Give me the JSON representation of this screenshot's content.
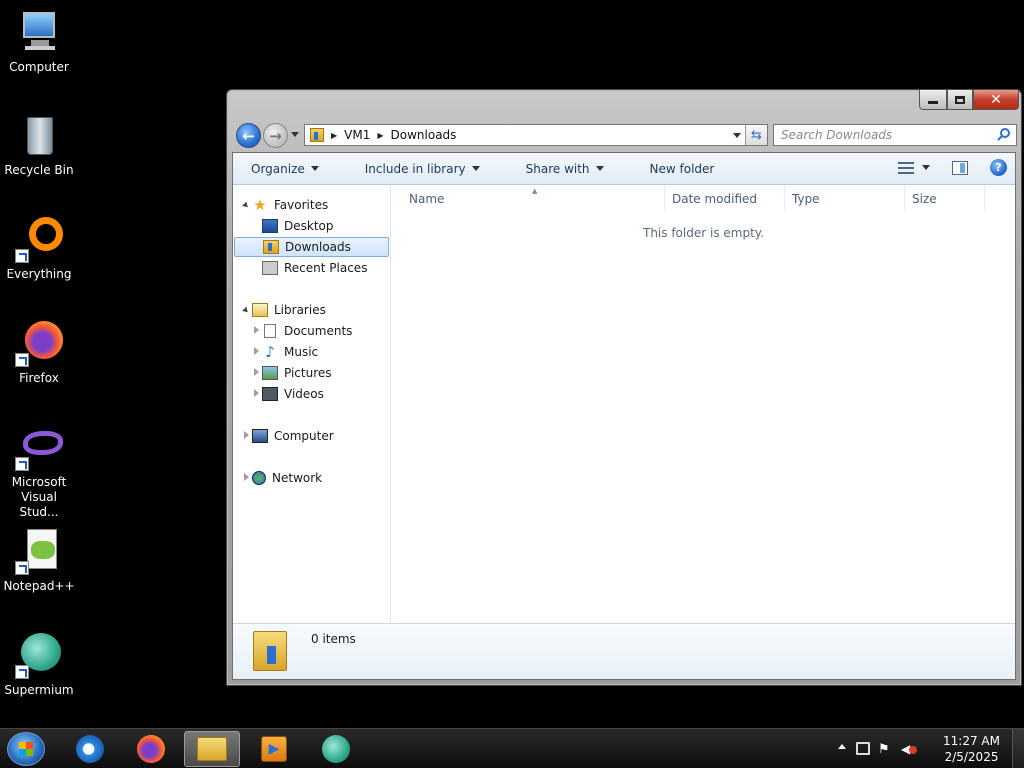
{
  "desktop": {
    "icons": [
      {
        "label": "Computer"
      },
      {
        "label": "Recycle Bin"
      },
      {
        "label": "Everything"
      },
      {
        "label": "Firefox"
      },
      {
        "label": "Microsoft Visual Stud..."
      },
      {
        "label": "Notepad++"
      },
      {
        "label": "Supermium"
      }
    ]
  },
  "window": {
    "breadcrumb": [
      "VM1",
      "Downloads"
    ],
    "search_placeholder": "Search Downloads",
    "toolbar": {
      "organize": "Organize",
      "include_in_library": "Include in library",
      "share_with": "Share with",
      "new_folder": "New folder",
      "help": "?"
    },
    "nav": {
      "favorites": "Favorites",
      "desktop": "Desktop",
      "downloads": "Downloads",
      "recent_places": "Recent Places",
      "libraries": "Libraries",
      "documents": "Documents",
      "music": "Music",
      "pictures": "Pictures",
      "videos": "Videos",
      "computer": "Computer",
      "network": "Network",
      "selected": "Downloads"
    },
    "columns": [
      "Name",
      "Date modified",
      "Type",
      "Size"
    ],
    "empty_message": "This folder is empty.",
    "details": {
      "items_count": "0 items"
    }
  },
  "taskbar": {
    "apps": [
      "internet-explorer",
      "firefox",
      "windows-explorer",
      "media-player",
      "supermium"
    ],
    "active_app": "windows-explorer",
    "clock": {
      "time": "11:27 AM",
      "date": "2/5/2025"
    }
  },
  "colors": {
    "accent": "#2a6fd1",
    "close_button": "#c4412b",
    "selection": "#cfe3fb"
  }
}
